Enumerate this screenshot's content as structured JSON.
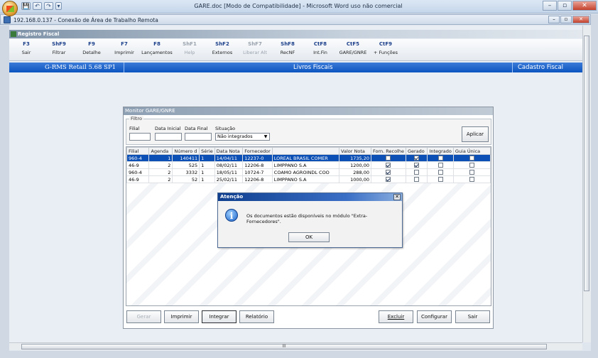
{
  "word": {
    "title": "GARE.doc [Modo de Compatibilidade] - Microsoft Word uso não comercial",
    "quick_access": [
      "💾",
      "↶",
      "↷",
      "▾"
    ],
    "controls": [
      "–",
      "▫",
      "✕"
    ]
  },
  "rdp": {
    "title": "192.168.0.137 - Conexão de Área de Trabalho Remota",
    "controls": [
      "–",
      "▫",
      "✕"
    ]
  },
  "app": {
    "window_title": "Registro Fiscal",
    "toolbar": [
      {
        "key": "F3",
        "label": "Sair",
        "enabled": true
      },
      {
        "key": "ShF9",
        "label": "Filtrar",
        "enabled": true
      },
      {
        "key": "F9",
        "label": "Detalhe",
        "enabled": true
      },
      {
        "key": "F7",
        "label": "Imprimir",
        "enabled": true
      },
      {
        "key": "F8",
        "label": "Lançamentos",
        "enabled": true
      },
      {
        "key": "ShF1",
        "label": "Help",
        "enabled": false
      },
      {
        "key": "ShF2",
        "label": "Externos",
        "enabled": true
      },
      {
        "key": "ShF7",
        "label": "Liberar Alt",
        "enabled": false
      },
      {
        "key": "ShF8",
        "label": "RecNF",
        "enabled": true
      },
      {
        "key": "CtF8",
        "label": "Int.Fin",
        "enabled": true
      },
      {
        "key": "CtF5",
        "label": "GARE/GNRE",
        "enabled": true
      },
      {
        "key": "CtF9",
        "label": "+ Funções",
        "enabled": true
      }
    ],
    "status_left": "G-RMS Retail 5.68 SP1",
    "status_center": "Livros Fiscais",
    "status_right": "Cadastro Fiscal"
  },
  "monitor": {
    "title": "Monitor GARE/GNRE",
    "filter_legend": "Filtro",
    "labels": {
      "filial": "Filial",
      "data_inicial": "Data Inicial",
      "data_final": "Data Final",
      "situacao": "Situação"
    },
    "values": {
      "filial": "",
      "data_inicial": "",
      "data_final": "",
      "situacao": "Não integrados"
    },
    "apply_label": "Aplicar",
    "columns": [
      "Filial",
      "Agenda",
      "Número d",
      "Série",
      "Data Nota",
      "Fornecedor",
      "Valor Nota",
      "Forn. Recolhe",
      "Gerado",
      "Integrado",
      "Guia Única"
    ],
    "rows": [
      {
        "filial": "960-4",
        "agenda": "1",
        "numero": "140411",
        "serie": "1",
        "data": "14/04/11",
        "forn_cod": "12237-0",
        "forn_nome": "LOREAL BRASIL COMER",
        "valor": "1735,20",
        "forn_recolhe": false,
        "gerado": true,
        "integrado": false,
        "guia_unica": false,
        "selected": true
      },
      {
        "filial": "46-9",
        "agenda": "2",
        "numero": "525",
        "serie": "1",
        "data": "08/02/11",
        "forn_cod": "12206-8",
        "forn_nome": "LIMPPANO S.A",
        "valor": "1200,00",
        "forn_recolhe": true,
        "gerado": true,
        "integrado": false,
        "guia_unica": false,
        "selected": false
      },
      {
        "filial": "960-4",
        "agenda": "2",
        "numero": "3332",
        "serie": "1",
        "data": "18/05/11",
        "forn_cod": "10724-7",
        "forn_nome": "COAMO AGROINDL COO",
        "valor": "288,00",
        "forn_recolhe": true,
        "gerado": false,
        "integrado": false,
        "guia_unica": false,
        "selected": false
      },
      {
        "filial": "46-9",
        "agenda": "2",
        "numero": "52",
        "serie": "1",
        "data": "25/02/11",
        "forn_cod": "12206-8",
        "forn_nome": "LIMPPANO S.A",
        "valor": "1000,00",
        "forn_recolhe": true,
        "gerado": false,
        "integrado": false,
        "guia_unica": false,
        "selected": false
      }
    ],
    "buttons": {
      "gerar": "Gerar",
      "imprimir": "Imprimir",
      "integrar": "Integrar",
      "relatorio": "Relatório",
      "excluir": "Excluir",
      "configurar": "Configurar",
      "sair": "Sair"
    }
  },
  "atencao": {
    "title": "Atenção",
    "close": "✕",
    "icon": "i",
    "message": "Os documentos estão disponíveis no módulo \"Extra-Fornecedores\".",
    "ok": "OK"
  },
  "hscroll_grip": "III"
}
